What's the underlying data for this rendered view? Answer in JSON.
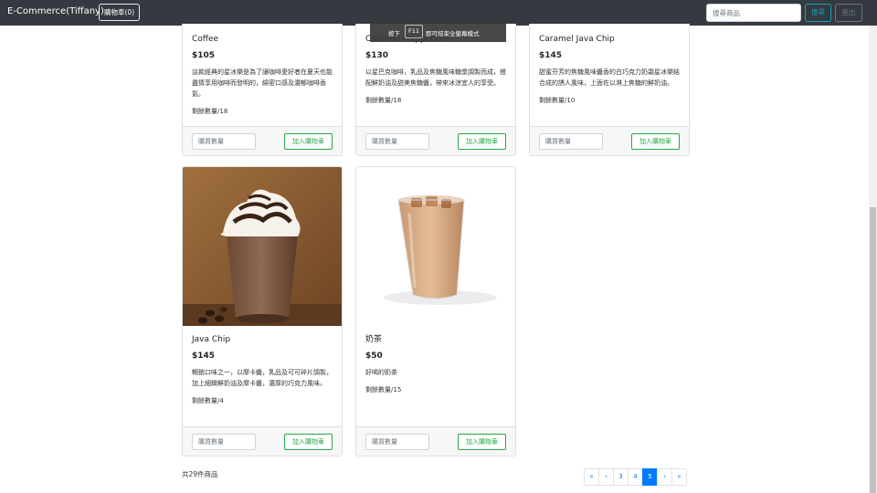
{
  "navbar": {
    "brand": "E-Commerce(Tiffany)",
    "cart_label": "購物車(0)",
    "search_placeholder": "搜尋商品",
    "search_label": "搜尋",
    "logout_label": "登出"
  },
  "toast": {
    "prefix": "按下",
    "key": "F11",
    "suffix": "即可結束全螢幕模式"
  },
  "products": [
    {
      "name": "Coffee",
      "price": "$105",
      "description": "這款經典的星冰樂是為了讓咖啡愛好者在夏天也能盡情享用咖啡而發明的，綿密口感及濃郁咖啡香氣。",
      "stock_label": "剩餘數量/",
      "stock": "18"
    },
    {
      "name": "Caramel Frappuccino",
      "price": "$130",
      "description": "以星巴克咖啡，乳品及焦糖風味糖漿調製而成，搭配鮮奶油及甜美焦糖醬，帶來冰涼宜人的享受。",
      "stock_label": "剩餘數量/",
      "stock": "18"
    },
    {
      "name": "Caramel Java Chip",
      "price": "$145",
      "description": "甜蜜芬芳的焦糖風味醬香的白巧克力奶霜星冰樂結合成的誘人風味，上面佐以淋上焦糖的鮮奶油。",
      "stock_label": "剩餘數量/",
      "stock": "10"
    },
    {
      "name": "Java Chip",
      "price": "$145",
      "description": "暢銷口味之一，以摩卡醬，乳品及可可碎片調製，加上細緻鮮奶油及摩卡醬，濃厚的巧克力風味。",
      "stock_label": "剩餘數量/",
      "stock": "4"
    },
    {
      "name": "奶茶",
      "price": "$50",
      "description": "好喝的奶茶",
      "stock_label": "剩餘數量/",
      "stock": "15"
    }
  ],
  "card_actions": {
    "qty_placeholder": "購買數量",
    "add_label": "加入購物車"
  },
  "footer": {
    "total_text": "共29件商品"
  },
  "pagination": {
    "first": "«",
    "prev": "‹",
    "pages": [
      "3",
      "4",
      "5"
    ],
    "current": "5",
    "next": "›",
    "last": "»"
  },
  "colors": {
    "navbar": "#343a40",
    "success": "#28a745",
    "info": "#17a2b8",
    "primary": "#007bff"
  },
  "icons": {
    "product_images": [
      "java-chip-frappuccino-photo",
      "iced-milk-tea-photo"
    ]
  }
}
